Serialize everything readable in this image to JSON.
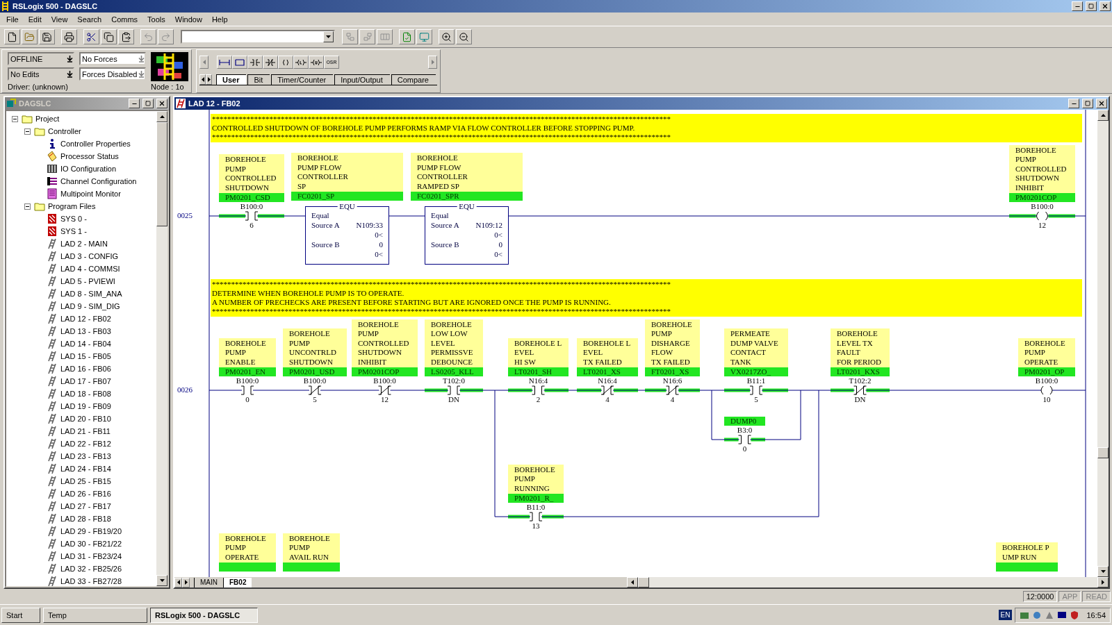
{
  "window": {
    "title": "RSLogix 500 - DAGSLC"
  },
  "menu": [
    "File",
    "Edit",
    "View",
    "Search",
    "Comms",
    "Tools",
    "Window",
    "Help"
  ],
  "status_panel": {
    "mode": "OFFLINE",
    "edits": "No Edits",
    "forces": "No Forces",
    "forces_enabled": "Forces Disabled",
    "driver": "Driver: (unknown)",
    "node": "Node : 1o"
  },
  "palette": {
    "buttons": [
      {
        "kind": "rung"
      },
      {
        "kind": "branch"
      },
      {
        "kind": "xic"
      },
      {
        "kind": "xio"
      },
      {
        "kind": "ote"
      },
      {
        "kind": "otl"
      },
      {
        "kind": "otu"
      },
      {
        "kind": "osr",
        "label": "OSR"
      }
    ],
    "tabs": [
      {
        "label": "User",
        "selected": true
      },
      {
        "label": "Bit",
        "selected": false
      },
      {
        "label": "Timer/Counter",
        "selected": false
      },
      {
        "label": "Input/Output",
        "selected": false
      },
      {
        "label": "Compare",
        "selected": false
      }
    ]
  },
  "project_tree": {
    "title": "DAGSLC",
    "items": [
      {
        "label": "Project",
        "kind": "folder",
        "expanded": true,
        "children": [
          {
            "label": "Controller",
            "kind": "folder",
            "expanded": true,
            "children": [
              {
                "label": "Controller Properties",
                "kind": "info"
              },
              {
                "label": "Processor Status",
                "kind": "status"
              },
              {
                "label": "IO Configuration",
                "kind": "io"
              },
              {
                "label": "Channel Configuration",
                "kind": "channel"
              },
              {
                "label": "Multipoint Monitor",
                "kind": "monitor"
              }
            ]
          },
          {
            "label": "Program Files",
            "kind": "folder",
            "expanded": true,
            "children": [
              {
                "label": "SYS 0 -",
                "kind": "system"
              },
              {
                "label": "SYS 1 -",
                "kind": "system"
              },
              {
                "label": "LAD 2 - MAIN",
                "kind": "ladder"
              },
              {
                "label": "LAD 3 - CONFIG",
                "kind": "ladder"
              },
              {
                "label": "LAD 4 - COMMSI",
                "kind": "ladder"
              },
              {
                "label": "LAD 5 - PVIEWI",
                "kind": "ladder"
              },
              {
                "label": "LAD 8 - SIM_ANA",
                "kind": "ladder"
              },
              {
                "label": "LAD 9 - SIM_DIG",
                "kind": "ladder"
              },
              {
                "label": "LAD 12 - FB02",
                "kind": "ladder"
              },
              {
                "label": "LAD 13 - FB03",
                "kind": "ladder"
              },
              {
                "label": "LAD 14 - FB04",
                "kind": "ladder"
              },
              {
                "label": "LAD 15 - FB05",
                "kind": "ladder"
              },
              {
                "label": "LAD 16 - FB06",
                "kind": "ladder"
              },
              {
                "label": "LAD 17 - FB07",
                "kind": "ladder"
              },
              {
                "label": "LAD 18 - FB08",
                "kind": "ladder"
              },
              {
                "label": "LAD 19 - FB09",
                "kind": "ladder"
              },
              {
                "label": "LAD 20 - FB10",
                "kind": "ladder"
              },
              {
                "label": "LAD 21 - FB11",
                "kind": "ladder"
              },
              {
                "label": "LAD 22 - FB12",
                "kind": "ladder"
              },
              {
                "label": "LAD 23 - FB13",
                "kind": "ladder"
              },
              {
                "label": "LAD 24 - FB14",
                "kind": "ladder"
              },
              {
                "label": "LAD 25 - FB15",
                "kind": "ladder"
              },
              {
                "label": "LAD 26 - FB16",
                "kind": "ladder"
              },
              {
                "label": "LAD 27 - FB17",
                "kind": "ladder"
              },
              {
                "label": "LAD 28 - FB18",
                "kind": "ladder"
              },
              {
                "label": "LAD 29 - FB19/20",
                "kind": "ladder"
              },
              {
                "label": "LAD 30 - FB21/22",
                "kind": "ladder"
              },
              {
                "label": "LAD 31 - FB23/24",
                "kind": "ladder"
              },
              {
                "label": "LAD 32 - FB25/26",
                "kind": "ladder"
              },
              {
                "label": "LAD 33 - FB27/28",
                "kind": "ladder"
              }
            ]
          }
        ]
      }
    ]
  },
  "ladder_window": {
    "title": "LAD 12 - FB02",
    "rungs": [
      {
        "number": "0025",
        "comment": [
          "************************************************************************************************************************",
          "CONTROLLED SHUTDOWN OF BOREHOLE PUMP PERFORMS RAMP VIA FLOW CONTROLLER BEFORE STOPPING PUMP.",
          "************************************************************************************************************************"
        ],
        "instructions": [
          {
            "kind": "xic",
            "description": [
              "BOREHOLE",
              "PUMP",
              "CONTROLLED",
              "SHUTDOWN"
            ],
            "symbol": "PM0201_CSD",
            "address": "B100:0",
            "bit": "6",
            "energized": true
          },
          {
            "kind": "equ",
            "description": [
              "BOREHOLE",
              "PUMP FLOW",
              "CONTROLLER",
              "SP"
            ],
            "symbol": "FC0201_SP",
            "mnemonic": "EQU",
            "name": "Equal",
            "source_a_label": "Source A",
            "source_a": "N109:33",
            "source_a_value": "0<",
            "source_b_label": "Source B",
            "source_b": "0",
            "source_b_value": "0<"
          },
          {
            "kind": "equ",
            "description": [
              "BOREHOLE",
              "PUMP FLOW",
              "CONTROLLER",
              "RAMPED SP"
            ],
            "symbol": "FC0201_SPR",
            "mnemonic": "EQU",
            "name": "Equal",
            "source_a_label": "Source A",
            "source_a": "N109:12",
            "source_a_value": "0<",
            "source_b_label": "Source B",
            "source_b": "0",
            "source_b_value": "0<"
          },
          {
            "kind": "ote",
            "description": [
              "BOREHOLE",
              "PUMP",
              "CONTROLLED",
              "SHUTDOWN",
              "INHIBIT"
            ],
            "symbol": "PM0201COP",
            "address": "B100:0",
            "bit": "12",
            "energized": true
          }
        ]
      },
      {
        "number": "0026",
        "comment": [
          "************************************************************************************************************************",
          "DETERMINE WHEN BOREHOLE PUMP IS TO OPERATE.",
          "A NUMBER OF PRECHECKS ARE PRESENT BEFORE STARTING BUT ARE IGNORED ONCE THE PUMP IS RUNNING.",
          "************************************************************************************************************************"
        ],
        "instructions": [
          {
            "kind": "xic",
            "description": [
              "BOREHOLE",
              "PUMP",
              "ENABLE"
            ],
            "symbol": "PM0201_EN",
            "address": "B100:0",
            "bit": "0",
            "energized": false
          },
          {
            "kind": "xio",
            "description": [
              "BOREHOLE",
              "PUMP",
              "UNCONTRLD",
              "SHUTDOWN"
            ],
            "symbol": "PM0201_USD",
            "address": "B100:0",
            "bit": "5",
            "energized": false
          },
          {
            "kind": "xio",
            "description": [
              "BOREHOLE",
              "PUMP",
              "CONTROLLED",
              "SHUTDOWN",
              "INHIBIT"
            ],
            "symbol": "PM0201COP",
            "address": "B100:0",
            "bit": "12",
            "energized": false
          },
          {
            "kind": "xic",
            "description": [
              "BOREHOLE",
              "LOW LOW",
              "LEVEL",
              "PERMISSVE",
              "DEBOUNCE"
            ],
            "symbol": "LS0205_KLL",
            "address": "T102:0",
            "bit": "DN",
            "energized": true
          },
          {
            "kind": "xic",
            "description": [
              "BOREHOLE L",
              "EVEL",
              "HI SW"
            ],
            "symbol": "LT0201_SH",
            "address": "N16:4",
            "bit": "2",
            "energized": true
          },
          {
            "kind": "xio",
            "description": [
              "BOREHOLE L",
              "EVEL",
              "TX FAILED"
            ],
            "symbol": "LT0201_XS",
            "address": "N16:4",
            "bit": "4",
            "energized": true
          },
          {
            "kind": "xio",
            "description": [
              "BOREHOLE",
              "PUMP",
              "DISHARGE",
              "FLOW",
              "TX FAILED"
            ],
            "symbol": "FT0201_XS",
            "address": "N16:6",
            "bit": "4",
            "energized": true
          },
          {
            "kind": "xic",
            "description": [
              "PERMEATE",
              "DUMP VALVE",
              "CONTACT",
              "TANK"
            ],
            "symbol": "VX0217ZO_",
            "address": "B11:1",
            "bit": "5",
            "energized": true
          },
          {
            "kind": "xio",
            "description": [
              "BOREHOLE",
              "LEVEL TX",
              "FAULT",
              "FOR PERIOD"
            ],
            "symbol": "LT0201_KXS",
            "address": "T102:2",
            "bit": "DN",
            "energized": true
          },
          {
            "kind": "ote",
            "description": [
              "BOREHOLE",
              "PUMP",
              "OPERATE"
            ],
            "symbol": "PM0201_OP",
            "address": "B100:0",
            "bit": "10",
            "energized": false
          },
          {
            "kind": "xic",
            "symbol": "DUMP0",
            "address": "B3:0",
            "bit": "0",
            "energized": true
          },
          {
            "kind": "xic",
            "description": [
              "BOREHOLE",
              "PUMP",
              "RUNNING"
            ],
            "symbol": "PM0201_R_",
            "address": "B11:0",
            "bit": "13",
            "energized": true
          }
        ]
      },
      {
        "instructions": [
          {
            "kind": "partial",
            "description": [
              "BOREHOLE",
              "PUMP",
              "OPERATE"
            ]
          },
          {
            "kind": "partial",
            "description": [
              "BOREHOLE",
              "PUMP",
              "AVAIL RUN"
            ]
          },
          {
            "kind": "partial",
            "description": [
              "BOREHOLE P",
              "UMP RUN"
            ]
          }
        ]
      }
    ],
    "sheet_tabs": [
      {
        "label": "MAIN",
        "selected": false
      },
      {
        "label": "FB02",
        "selected": true
      }
    ]
  },
  "status_bar": [
    "12:0000",
    "APP",
    "READ"
  ],
  "taskbar": {
    "buttons": [
      {
        "label": "Start",
        "selected": false
      },
      {
        "label": "Temp",
        "selected": false
      },
      {
        "label": "RSLogix 500 - DAGSLC",
        "selected": true
      }
    ],
    "language": "EN",
    "clock": "16:54"
  }
}
